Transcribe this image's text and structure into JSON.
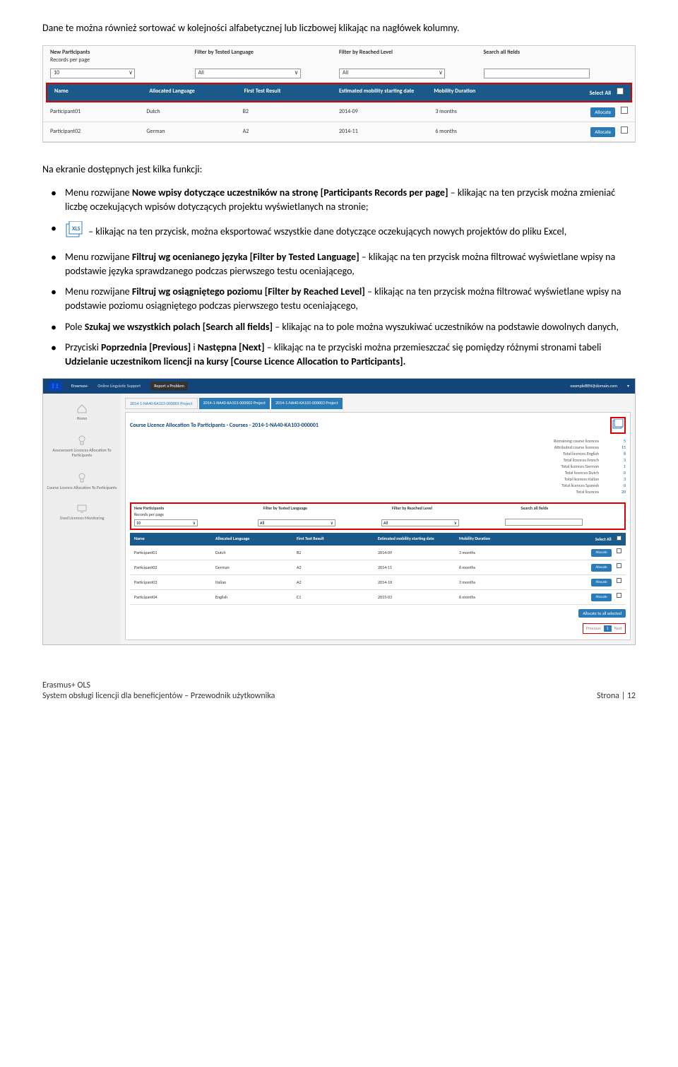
{
  "intro": "Dane te można również sortować w kolejności alfabetycznej lub liczbowej klikając na nagłówek kolumny.",
  "s1": {
    "filters": {
      "new_participants": "New Participants",
      "records_per_page": "Records per page",
      "records_val": "10",
      "tested_lang": "Filter by Tested Language",
      "tested_val": "All",
      "reached": "Filter by Reached Level",
      "reached_val": "All",
      "search": "Search all fields"
    },
    "columns": [
      "Name",
      "Allocated Language",
      "First Test Result",
      "Estimated mobility starting date",
      "Mobility Duration",
      "Select All"
    ],
    "rows": [
      {
        "name": "Participant01",
        "lang": "Dutch",
        "result": "B2",
        "date": "2014-09",
        "dur": "3 months",
        "btn": "Allocate"
      },
      {
        "name": "Participant02",
        "lang": "German",
        "result": "A2",
        "date": "2014-11",
        "dur": "6 months",
        "btn": "Allocate"
      }
    ]
  },
  "heading2": "Na ekranie dostępnych jest kilka funkcji:",
  "bullets": {
    "b1_pre": "Menu rozwijane ",
    "b1_bold": "Nowe wpisy dotyczące uczestników na stronę [Participants Records per page]",
    "b1_post": " – klikając na ten przycisk można zmieniać liczbę oczekujących wpisów dotyczących projektu wyświetlanych na stronie;",
    "b2": " – klikając na ten przycisk, można eksportować wszystkie dane dotyczące oczekujących nowych projektów do pliku Excel,",
    "b3_pre": "Menu rozwijane ",
    "b3_bold": "Filtruj wg ocenianego języka [Filter by Tested Language]",
    "b3_post": " – klikając na ten przycisk można filtrować wyświetlane wpisy na podstawie języka sprawdzanego podczas pierwszego testu oceniającego,",
    "b4_pre": "Menu rozwijane ",
    "b4_bold": "Filtruj wg osiągniętego poziomu [Filter by Reached Level]",
    "b4_post": " –  klikając na ten przycisk można filtrować wyświetlane wpisy na podstawie poziomu osiągniętego podczas pierwszego testu oceniającego,",
    "b5_pre": "Pole ",
    "b5_bold": "Szukaj we wszystkich polach [Search all fields]",
    "b5_post": " – klikając na to pole można wyszukiwać uczestników na podstawie dowolnych danych,",
    "b6_pre": "Przyciski ",
    "b6_bold1": "Poprzednia [Previous]",
    "b6_mid": " i ",
    "b6_bold2": "Następna [Next]",
    "b6_post1": " – klikając na te przyciski można przemieszczać się pomiędzy różnymi stronami tabeli ",
    "b6_bold3": "Udzielanie uczestnikom licencji na kursy [Course Licence Allocation to Participants]."
  },
  "s2": {
    "top": {
      "brand": "Erasmus+",
      "ols": "Online Linguistic Support",
      "report": "Report a Problem",
      "user": "exampleBEN@domain.com"
    },
    "sidebar": {
      "home": "Home",
      "assess": "Assessment Licences Allocation To Participants",
      "course": "Course Licence Allocation To Participants",
      "used": "Used Licences Monitoring"
    },
    "tabs": [
      "2014-1-NA40-KA103-000001 Project",
      "2014-1-NA40-KA103-000002 Project",
      "2014-1-NA40-KA103-000003 Project"
    ],
    "panel_title": "Course Licence Allocation To Participants - Courses - 2014-1-NA40-KA103-000001",
    "stats": [
      {
        "label": "Remaining course licences",
        "val": "5"
      },
      {
        "label": "Attributed course licences",
        "val": "15"
      },
      {
        "label": "Total licences English",
        "val": "8"
      },
      {
        "label": "Total licences French",
        "val": "3"
      },
      {
        "label": "Total licences German",
        "val": "1"
      },
      {
        "label": "Total licences Dutch",
        "val": "0"
      },
      {
        "label": "Total licences Italian",
        "val": "3"
      },
      {
        "label": "Total licences Spanish",
        "val": "0"
      },
      {
        "label": "Total licences",
        "val": "20"
      }
    ],
    "filters": {
      "new_participants": "New Participants",
      "records": "Records per page",
      "records_val": "10",
      "tested": "Filter by Tested Language",
      "tested_val": "All",
      "reached": "Filter by Reached Level",
      "reached_val": "All",
      "search": "Search all fields"
    },
    "columns": [
      "Name",
      "Allocated Language",
      "First Test Result",
      "Estimated mobility starting date",
      "Mobility Duration",
      "Select All"
    ],
    "rows": [
      {
        "name": "Participant01",
        "lang": "Dutch",
        "result": "B2",
        "date": "2014-09",
        "dur": "3 months",
        "btn": "Allocate"
      },
      {
        "name": "Participant02",
        "lang": "German",
        "result": "A2",
        "date": "2014-11",
        "dur": "6 months",
        "btn": "Allocate"
      },
      {
        "name": "Participant03",
        "lang": "Italian",
        "result": "A2",
        "date": "2014-10",
        "dur": "3 months",
        "btn": "Allocate"
      },
      {
        "name": "Participant04",
        "lang": "English",
        "result": "C1",
        "date": "2015-03",
        "dur": "6 months",
        "btn": "Allocate"
      }
    ],
    "alloc_all": "Allocate to all selected",
    "pager": {
      "prev": "Previous",
      "page": "1",
      "next": "Next"
    }
  },
  "footer": {
    "l1": "Erasmus+ OLS",
    "l2": "System obsługi licencji dla beneficjentów – Przewodnik użytkownika",
    "page": "Strona | 12"
  }
}
